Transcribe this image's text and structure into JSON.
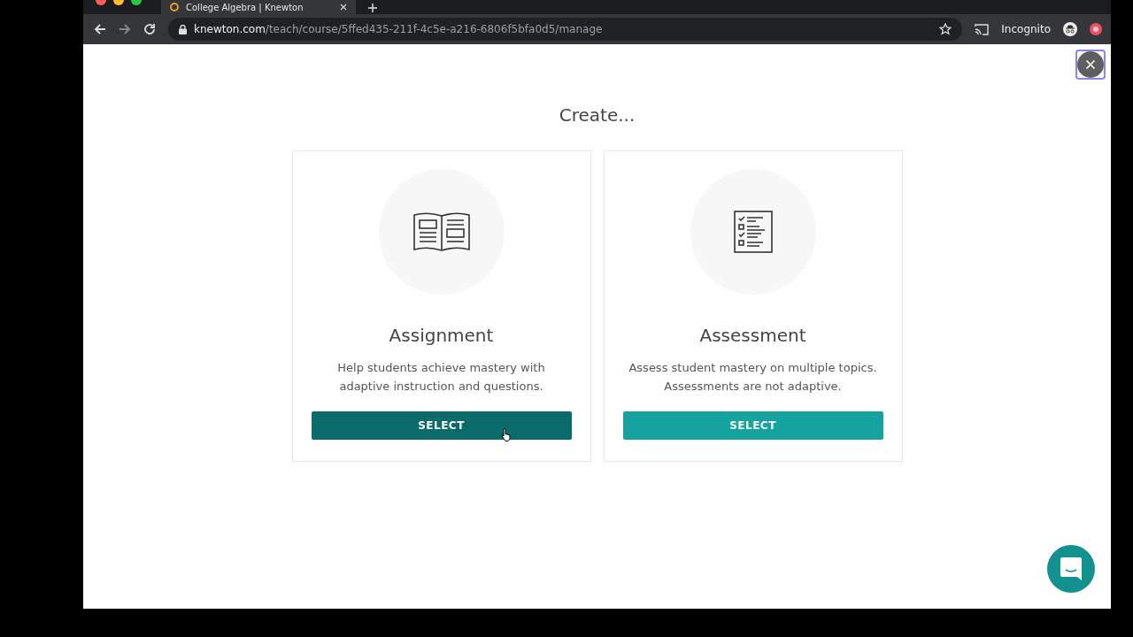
{
  "browser": {
    "tab": {
      "title": "College Algebra | Knewton",
      "selected": true
    },
    "url": {
      "host": "knewton.com",
      "path": "/teach/course/5ffed435-211f-4c5e-a216-6806f5bfa0d5/manage"
    },
    "profile": "Incognito"
  },
  "dialog": {
    "title": "Create...",
    "cards": [
      {
        "kind": "book",
        "title": "Assignment",
        "description": "Help students achieve mastery with adaptive instruction and questions.",
        "button": "SELECT",
        "hovered": true
      },
      {
        "kind": "checklist",
        "title": "Assessment",
        "description": "Assess student mastery on multiple topics. Assessments are not adaptive.",
        "button": "SELECT",
        "hovered": false
      }
    ]
  }
}
